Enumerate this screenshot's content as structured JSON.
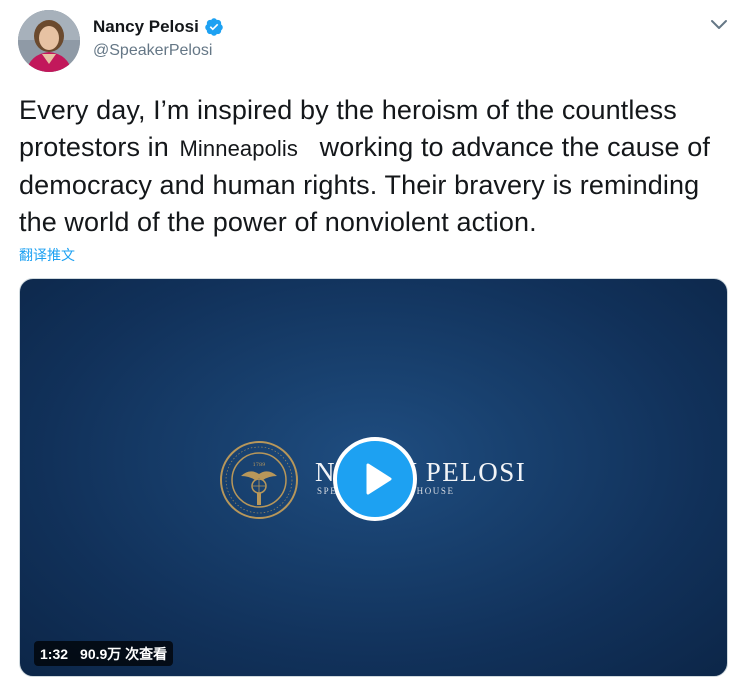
{
  "user": {
    "display_name": "Nancy Pelosi",
    "handle": "@SpeakerPelosi",
    "verified_color": "#1da1f2"
  },
  "tweet": {
    "text_part1": "Every day, I’m inspired by the heroism of the countless protestors in",
    "place": "Minneapolis",
    "text_part2": "working to advance the cause of democracy and human rights. Their bravery is reminding the world of the power of nonviolent action.",
    "translate_label": "翻译推文"
  },
  "media": {
    "brand_name": "NANCY PELOSI",
    "brand_subtitle": "SPEAKER OF THE HOUSE",
    "seal_year": "1789",
    "duration": "1:32",
    "views": "90.9万 次查看"
  },
  "colors": {
    "accent": "#1da1f2",
    "media_bg": "#11315a",
    "seal_gold": "#b8975a"
  },
  "icons": [
    "verified-badge-icon",
    "caret-down-icon",
    "play-icon",
    "speaker-seal-icon",
    "avatar-image"
  ]
}
